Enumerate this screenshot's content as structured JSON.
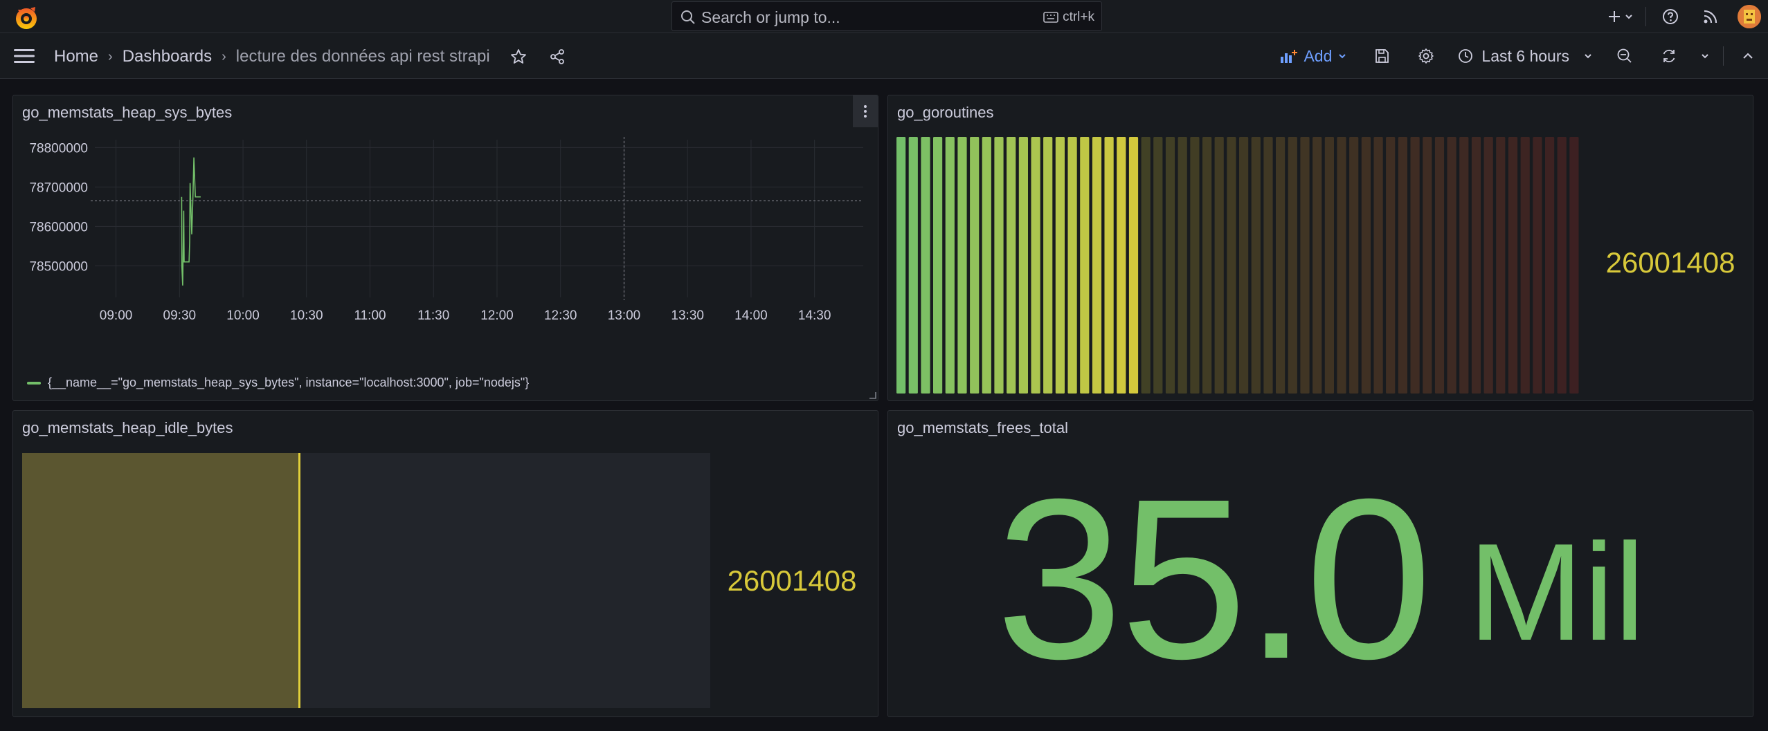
{
  "topbar": {
    "search_placeholder": "Search or jump to...",
    "search_shortcut": "ctrl+k",
    "icons": [
      "grafana-logo-icon",
      "search-icon",
      "keyboard-icon",
      "plus-icon",
      "chevron-down-icon",
      "help-icon",
      "rss-icon",
      "avatar"
    ]
  },
  "breadcrumb": {
    "home": "Home",
    "dashboards": "Dashboards",
    "current": "lecture des données api rest strapi"
  },
  "toolbar": {
    "add_label": "Add",
    "time_range": "Last 6 hours"
  },
  "colors": {
    "background": "#111217",
    "panel": "#181b1f",
    "green": "#73bf69",
    "yellow": "#d8c93a",
    "red": "#c4342d",
    "accent_blue": "#6e9fff"
  },
  "panels": {
    "heap_sys": {
      "title": "go_memstats_heap_sys_bytes",
      "legend": "{__name__=\"go_memstats_heap_sys_bytes\", instance=\"localhost:3000\", job=\"nodejs\"}"
    },
    "goroutines": {
      "title": "go_goroutines",
      "value": "26001408",
      "gauge_fraction": 0.36,
      "segment_count": 56
    },
    "heap_idle": {
      "title": "go_memstats_heap_idle_bytes",
      "value": "26001408",
      "gauge_fraction": 0.404
    },
    "frees_total": {
      "title": "go_memstats_frees_total",
      "value": "35.0",
      "unit": "Mil"
    }
  },
  "chart_data": {
    "type": "line",
    "title": "go_memstats_heap_sys_bytes",
    "xlabel": "",
    "ylabel": "",
    "x_ticks": [
      "09:00",
      "09:30",
      "10:00",
      "10:30",
      "11:00",
      "11:30",
      "12:00",
      "12:30",
      "13:00",
      "13:30",
      "14:00",
      "14:30"
    ],
    "y_ticks": [
      78500000,
      78600000,
      78700000,
      78800000
    ],
    "ylim": [
      78420000,
      78820000
    ],
    "xlim_minutes": [
      530,
      893
    ],
    "grid": true,
    "legend_placement": "bottom-left",
    "series": [
      {
        "name": "{__name__=\"go_memstats_heap_sys_bytes\", instance=\"localhost:3000\", job=\"nodejs\"}",
        "color": "#73bf69",
        "points": [
          [
            571.0,
            78675000
          ],
          [
            571.1,
            78500000
          ],
          [
            571.5,
            78450000
          ],
          [
            572.0,
            78640000
          ],
          [
            572.2,
            78510000
          ],
          [
            573.0,
            78510000
          ],
          [
            574.5,
            78510000
          ],
          [
            574.8,
            78560000
          ],
          [
            575.0,
            78710000
          ],
          [
            575.8,
            78580000
          ],
          [
            576.3,
            78670000
          ],
          [
            576.8,
            78775000
          ],
          [
            577.5,
            78675000
          ],
          [
            580.0,
            78675000
          ]
        ]
      }
    ],
    "crosshair": {
      "x_minutes": 780,
      "y": 78665000
    }
  }
}
